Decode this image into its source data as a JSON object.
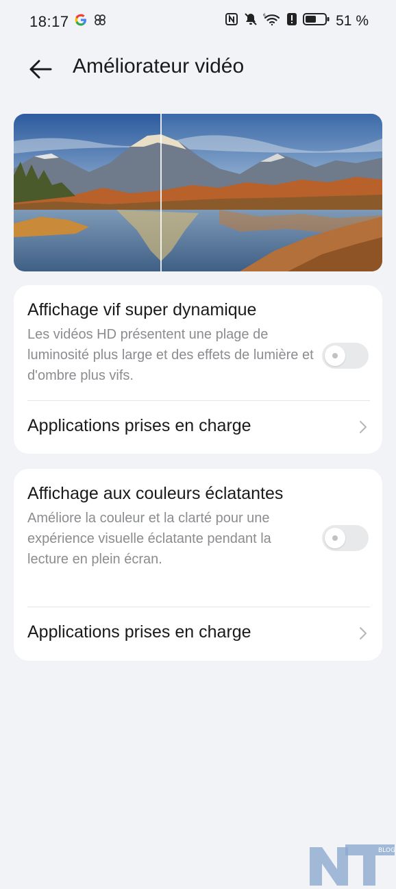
{
  "status_bar": {
    "time": "18:17",
    "battery": "51 %",
    "icons": [
      "google-icon",
      "pinwheel-icon",
      "nfc-icon",
      "bell-muted-icon",
      "wifi-icon",
      "alert-icon",
      "battery-icon"
    ]
  },
  "header": {
    "back_icon": "arrow-left-icon",
    "title": "Améliorateur vidéo"
  },
  "preview": {
    "description_icon": "landscape-preview"
  },
  "settings": [
    {
      "title": "Affichage vif super dynamique",
      "description": "Les vidéos HD présentent une plage de luminosité plus large et des effets de lumière et d'ombre plus vifs.",
      "enabled": false,
      "link_label": "Applications prises en charge"
    },
    {
      "title": "Affichage aux couleurs éclatantes",
      "description": "Améliore la couleur et la clarté pour une expérience visuelle éclatante pendant la lecture en plein écran.",
      "enabled": false,
      "link_label": "Applications prises en charge"
    }
  ],
  "watermark": {
    "letters": "NT",
    "tag": "BLOG"
  },
  "colors": {
    "background": "#f1f3f6",
    "card": "#ffffff",
    "text_primary": "#1a1a1a",
    "text_secondary": "#8a8c8f",
    "toggle_off": "#e8e9eb"
  }
}
